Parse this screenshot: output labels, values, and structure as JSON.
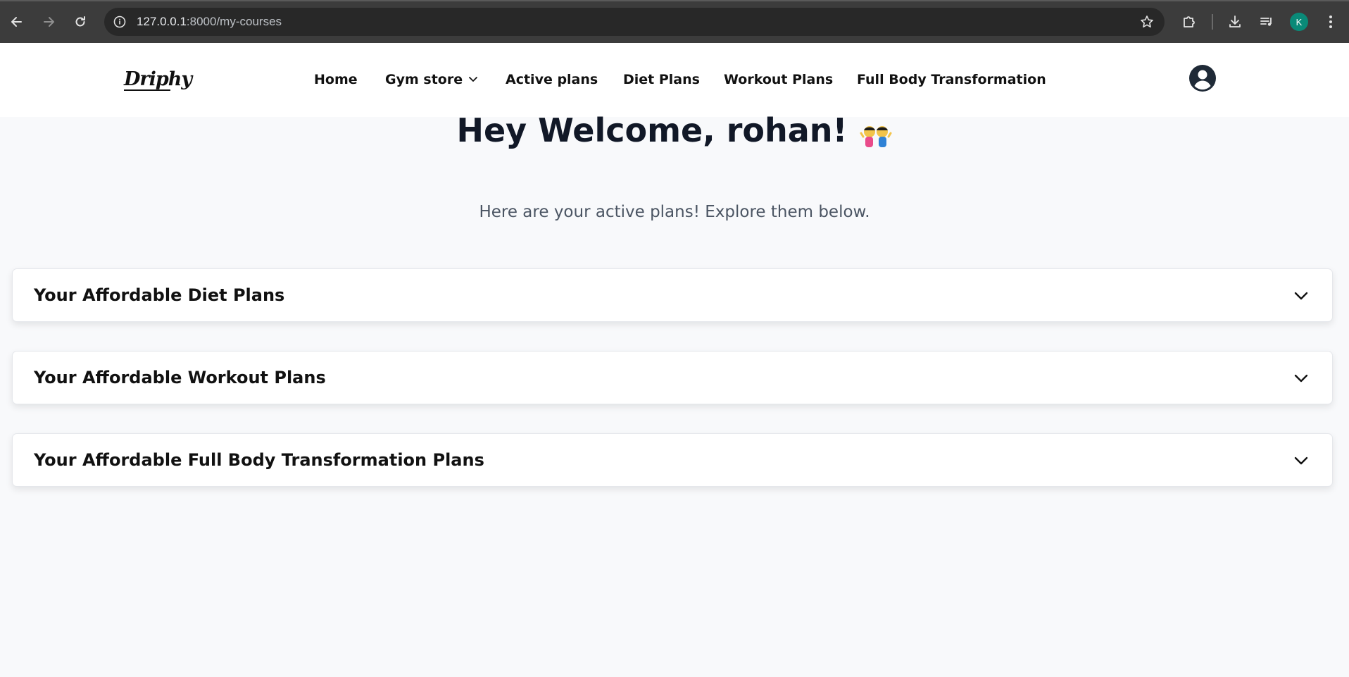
{
  "browser": {
    "url_host": "127.0.0.1",
    "url_path": ":8000/my-courses",
    "profile_initial": "K",
    "profile_color": "#0a8a78"
  },
  "site": {
    "logo": "Driphy",
    "nav": [
      {
        "label": "Home"
      },
      {
        "label": "Gym store"
      },
      {
        "label": "Active plans"
      },
      {
        "label": "Diet Plans"
      },
      {
        "label": "Workout Plans"
      },
      {
        "label": "Full Body Transformation"
      }
    ]
  },
  "main": {
    "welcome": "Hey Welcome, rohan!",
    "subtitle": "Here are your active plans! Explore them below.",
    "sections": [
      {
        "title": "Your Affordable Diet Plans"
      },
      {
        "title": "Your Affordable Workout Plans"
      },
      {
        "title": "Your Affordable Full Body Transformation Plans"
      }
    ]
  },
  "icons": {
    "back": "arrow-left-icon",
    "forward": "arrow-right-icon",
    "reload": "reload-icon",
    "info": "info-icon",
    "bookmark": "star-icon",
    "extensions": "puzzle-icon",
    "download": "download-icon",
    "media": "media-queue-icon",
    "menu": "kebab-menu-icon",
    "user": "user-circle-icon",
    "dropdown": "chevron-down-icon",
    "emoji": "people-celebrating-emoji"
  }
}
